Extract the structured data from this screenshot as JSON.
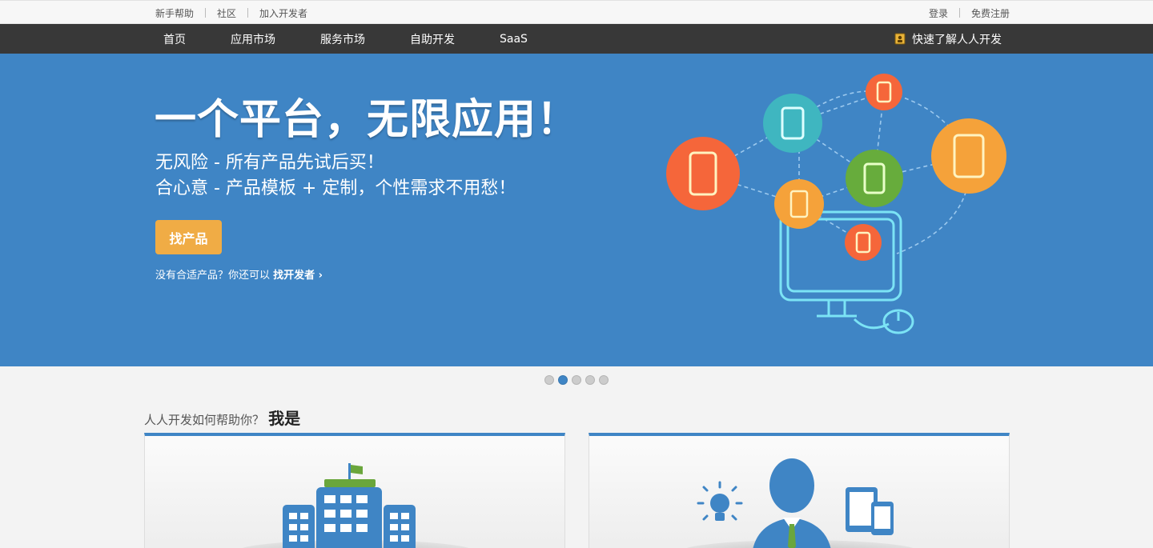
{
  "topbar": {
    "left_links": [
      "新手帮助",
      "社区",
      "加入开发者"
    ],
    "right_links": [
      "登录",
      "免费注册"
    ]
  },
  "nav": {
    "items": [
      "首页",
      "应用市场",
      "服务市场",
      "自助开发",
      "SaaS"
    ],
    "quick_link": "快速了解人人开发"
  },
  "banner": {
    "headline": "一个平台，无限应用！",
    "sub1": "无风险 - 所有产品先试后买！",
    "sub2": "合心意 - 产品模板 + 定制，个性需求不用愁！",
    "button": "找产品",
    "tip_text": "没有合适产品？你还可以",
    "tip_link": "找开发者 ›"
  },
  "carousel": {
    "count": 5,
    "active_index": 1
  },
  "section": {
    "question": "人人开发如何帮助你？",
    "bold": "我是"
  },
  "colors": {
    "primary_blue": "#3f85c5",
    "nav_dark": "#383838",
    "button_orange": "#f0ac45"
  }
}
